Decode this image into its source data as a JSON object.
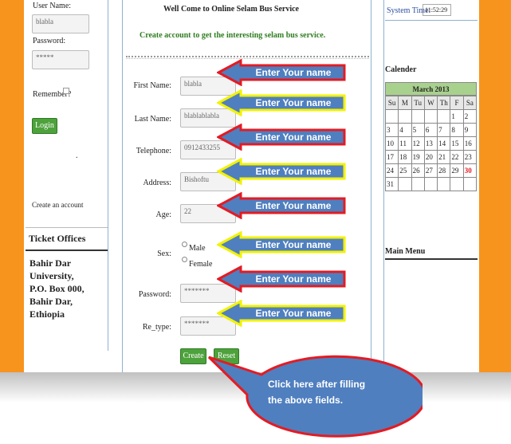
{
  "login": {
    "username_label": "User Name:",
    "username_value": "blabla",
    "password_label": "Password:",
    "password_value": "*****",
    "remember_label": "Remember?",
    "login_button": "Login",
    "dot": ".",
    "create_account": "Create an account"
  },
  "ticket_offices": {
    "title": "Ticket Offices",
    "line1": "Bahir Dar",
    "line2": "University,",
    "line3": "P.O. Box 000,",
    "line4": "Bahir Dar,",
    "line5": "Ethiopia"
  },
  "main": {
    "welcome": "Well Come to Online Selam Bus Service",
    "subtitle": "Create account to get the interesting selam bus service.",
    "fields": [
      {
        "label": "First Name:",
        "value": "blabla"
      },
      {
        "label": "Last Name:",
        "value": "blablablabla"
      },
      {
        "label": "Telephone:",
        "value": "0912433255"
      },
      {
        "label": "Address:",
        "value": "Bishoftu"
      },
      {
        "label": "Age:",
        "value": "22"
      },
      {
        "label": "Sex:",
        "value": ""
      },
      {
        "label": "Password:",
        "value": "*******"
      },
      {
        "label": "Re_type:",
        "value": "*******"
      }
    ],
    "sex_options": [
      "Male",
      "Female"
    ],
    "create_button": "Create",
    "reset_button": "Reset"
  },
  "annotations": {
    "arrow_text": "Enter Your name",
    "callout_line1": "Click here after filling",
    "callout_line2": "the above fields."
  },
  "right": {
    "system_time_label": "System Time:",
    "system_time_value": "11:52:29",
    "calendar_label": "Calender",
    "month": "March 2013",
    "days": [
      "Su",
      "M",
      "Tu",
      "W",
      "Th",
      "F",
      "Sa"
    ],
    "weeks": [
      [
        "",
        "",
        "",
        "",
        "",
        "1",
        "2"
      ],
      [
        "3",
        "4",
        "5",
        "6",
        "7",
        "8",
        "9"
      ],
      [
        "10",
        "11",
        "12",
        "13",
        "14",
        "15",
        "16"
      ],
      [
        "17",
        "18",
        "19",
        "20",
        "21",
        "22",
        "23"
      ],
      [
        "24",
        "25",
        "26",
        "27",
        "28",
        "29",
        "30"
      ],
      [
        "31",
        "",
        "",
        "",
        "",
        "",
        ""
      ]
    ],
    "today": "30",
    "main_menu": "Main Menu"
  },
  "colors": {
    "orange": "#f7941d",
    "green_button": "#4ea23c",
    "arrow_fill": "#4f7fbf",
    "arrow_red_border": "#e31b23",
    "arrow_yellow_border": "#f2f200",
    "today_red": "#e31b23"
  }
}
